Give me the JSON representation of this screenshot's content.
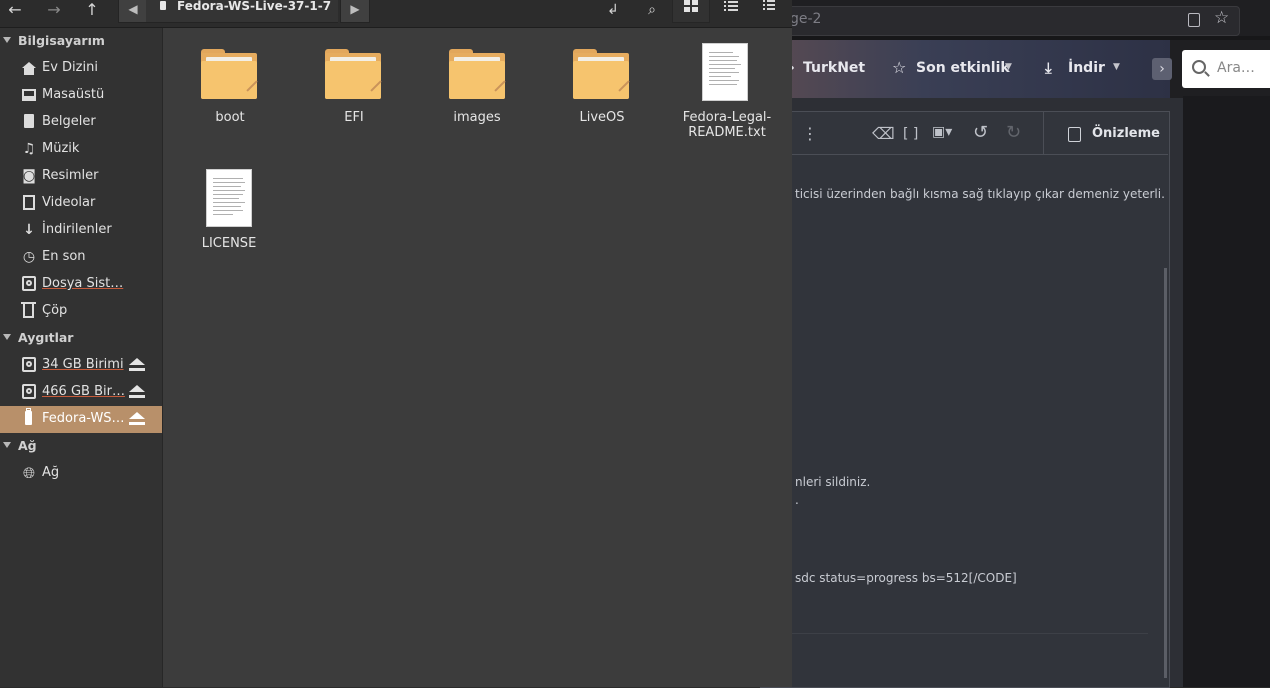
{
  "browser": {
    "url_fragment": "ge-2",
    "nav": {
      "turknet": "TurkNet",
      "recent": "Son etkinlik",
      "download": "İndir",
      "search_placeholder": "Ara…"
    },
    "toolbar": {
      "preview": "Önizleme"
    },
    "editor_lines": [
      "ticisi üzerinden bağlı kısma sağ tıklayıp çıkar demeniz yeterli.",
      "nleri sildiniz.",
      ".",
      "sdc status=progress bs=512[/CODE]"
    ]
  },
  "file_manager": {
    "path": {
      "current": "Fedora-WS-Live-37-1-7"
    },
    "sidebar": {
      "sections": [
        {
          "label": "Bilgisayarım"
        },
        {
          "label": "Aygıtlar"
        },
        {
          "label": "Ağ"
        }
      ],
      "places": [
        {
          "label": "Ev Dizini",
          "icon": "home-icon"
        },
        {
          "label": "Masaüstü",
          "icon": "desktop-icon"
        },
        {
          "label": "Belgeler",
          "icon": "document-icon"
        },
        {
          "label": "Müzik",
          "icon": "music-icon"
        },
        {
          "label": "Resimler",
          "icon": "camera-icon"
        },
        {
          "label": "Videolar",
          "icon": "film-icon"
        },
        {
          "label": "İndirilenler",
          "icon": "download-icon"
        },
        {
          "label": "En son",
          "icon": "recent-icon"
        },
        {
          "label": "Dosya Sist…",
          "icon": "drive-icon"
        },
        {
          "label": "Çöp",
          "icon": "trash-icon"
        }
      ],
      "devices": [
        {
          "label": "34 GB Birimi",
          "icon": "drive-icon"
        },
        {
          "label": "466 GB Bir…",
          "icon": "drive-icon"
        },
        {
          "label": "Fedora-WS…",
          "icon": "usb-drive-icon",
          "selected": true
        }
      ],
      "network": [
        {
          "label": "Ağ",
          "icon": "network-icon"
        }
      ]
    },
    "files": [
      {
        "name": "boot",
        "type": "folder"
      },
      {
        "name": "EFI",
        "type": "folder"
      },
      {
        "name": "images",
        "type": "folder"
      },
      {
        "name": "LiveOS",
        "type": "folder"
      },
      {
        "name_line1": "Fedora-Legal-",
        "name_line2": "README.txt",
        "type": "text"
      },
      {
        "name": "LICENSE",
        "type": "text"
      }
    ]
  }
}
